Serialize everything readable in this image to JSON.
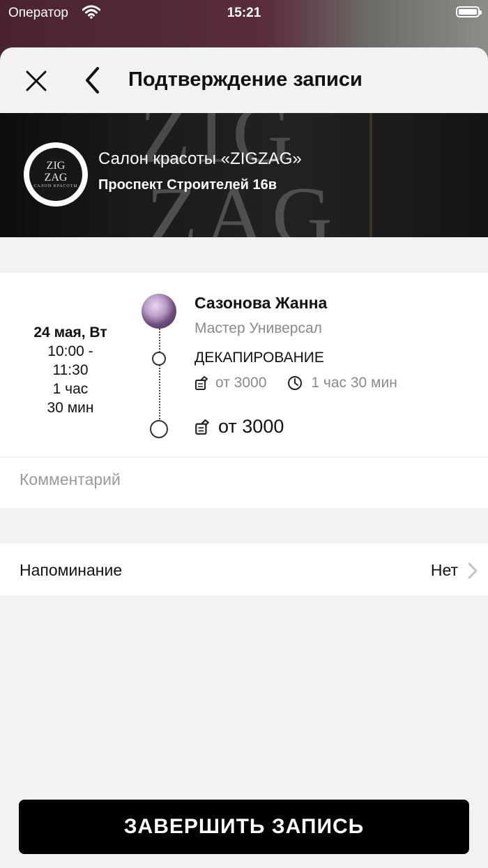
{
  "status_bar": {
    "carrier": "Оператор",
    "time": "15:21"
  },
  "header": {
    "title": "Подтверждение записи",
    "close_icon": "close-icon",
    "back_icon": "chevron-left-icon"
  },
  "salon": {
    "name": "Салон красоты «ZIGZAG»",
    "address": "Проспект Строителей 16в",
    "logo_line1": "ZIG",
    "logo_line2": "ZAG",
    "logo_sub": "САЛОН КРАСОТЫ",
    "banner_text1": "ZIG",
    "banner_text2": "ZAG"
  },
  "appointment": {
    "date": "24 мая, Вт",
    "time_start": "10:00 -",
    "time_end": "11:30",
    "duration_line1": "1 час",
    "duration_line2": "30 мин",
    "master_name": "Сазонова Жанна",
    "master_role": "Мастер Универсал",
    "service_name": "ДЕКАПИРОВАНИЕ",
    "service_price": "от 3000",
    "service_duration": "1 час 30 мин",
    "total": "от 3000"
  },
  "comment": {
    "placeholder": "Комментарий"
  },
  "reminder": {
    "label": "Напоминание",
    "value": "Нет"
  },
  "submit": {
    "label": "ЗАВЕРШИТЬ ЗАПИСЬ"
  },
  "colors": {
    "sheet_bg": "#f2f2f2",
    "button_bg": "#000000",
    "muted_text": "#8a8a8a"
  }
}
